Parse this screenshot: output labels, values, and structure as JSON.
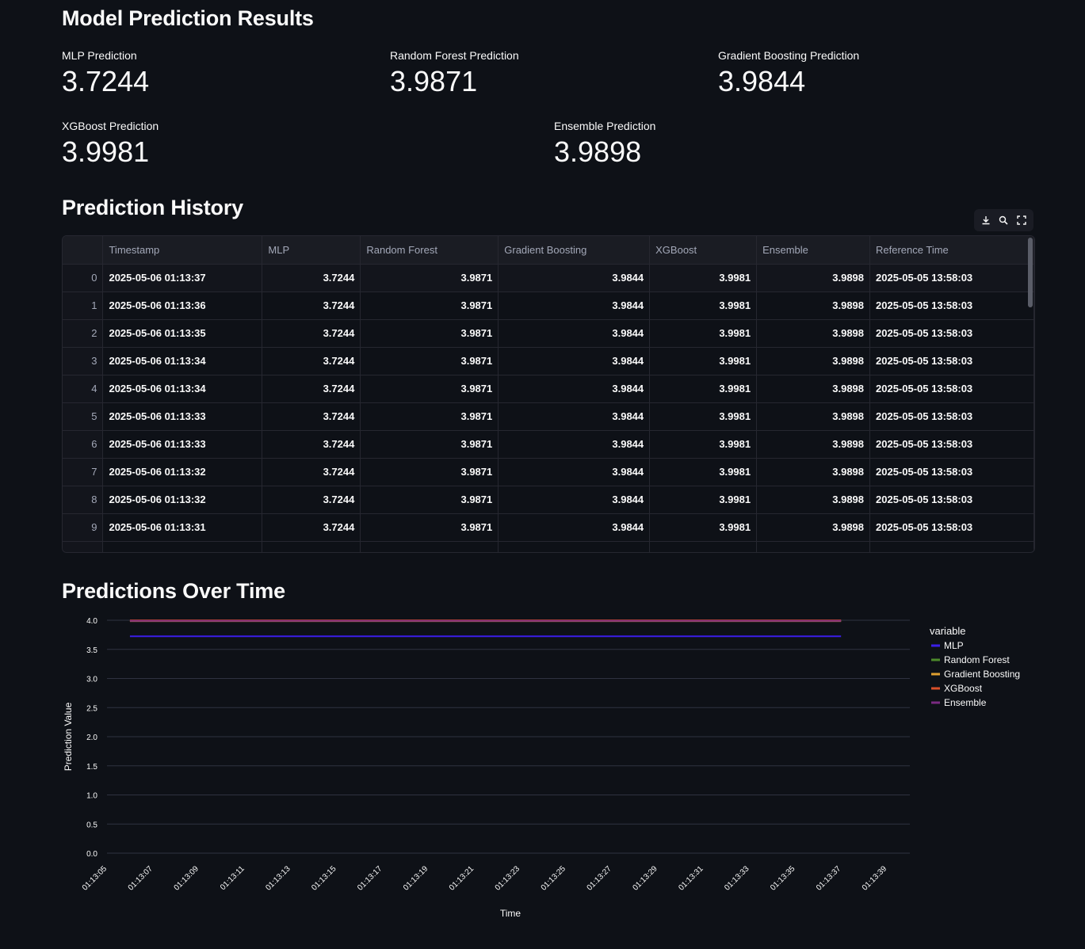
{
  "results": {
    "title": "Model Prediction Results",
    "metrics": [
      {
        "label": "MLP Prediction",
        "value": "3.7244"
      },
      {
        "label": "Random Forest Prediction",
        "value": "3.9871"
      },
      {
        "label": "Gradient Boosting Prediction",
        "value": "3.9844"
      },
      {
        "label": "XGBoost Prediction",
        "value": "3.9981"
      },
      {
        "label": "Ensemble Prediction",
        "value": "3.9898"
      }
    ]
  },
  "history": {
    "title": "Prediction History",
    "toolbar": {
      "download_icon": "download-icon",
      "search_icon": "search-icon",
      "fullscreen_icon": "fullscreen-icon"
    },
    "columns": [
      "",
      "Timestamp",
      "MLP",
      "Random Forest",
      "Gradient Boosting",
      "XGBoost",
      "Ensemble",
      "Reference Time"
    ],
    "rows": [
      [
        "0",
        "2025-05-06 01:13:37",
        "3.7244",
        "3.9871",
        "3.9844",
        "3.9981",
        "3.9898",
        "2025-05-05 13:58:03"
      ],
      [
        "1",
        "2025-05-06 01:13:36",
        "3.7244",
        "3.9871",
        "3.9844",
        "3.9981",
        "3.9898",
        "2025-05-05 13:58:03"
      ],
      [
        "2",
        "2025-05-06 01:13:35",
        "3.7244",
        "3.9871",
        "3.9844",
        "3.9981",
        "3.9898",
        "2025-05-05 13:58:03"
      ],
      [
        "3",
        "2025-05-06 01:13:34",
        "3.7244",
        "3.9871",
        "3.9844",
        "3.9981",
        "3.9898",
        "2025-05-05 13:58:03"
      ],
      [
        "4",
        "2025-05-06 01:13:34",
        "3.7244",
        "3.9871",
        "3.9844",
        "3.9981",
        "3.9898",
        "2025-05-05 13:58:03"
      ],
      [
        "5",
        "2025-05-06 01:13:33",
        "3.7244",
        "3.9871",
        "3.9844",
        "3.9981",
        "3.9898",
        "2025-05-05 13:58:03"
      ],
      [
        "6",
        "2025-05-06 01:13:33",
        "3.7244",
        "3.9871",
        "3.9844",
        "3.9981",
        "3.9898",
        "2025-05-05 13:58:03"
      ],
      [
        "7",
        "2025-05-06 01:13:32",
        "3.7244",
        "3.9871",
        "3.9844",
        "3.9981",
        "3.9898",
        "2025-05-05 13:58:03"
      ],
      [
        "8",
        "2025-05-06 01:13:32",
        "3.7244",
        "3.9871",
        "3.9844",
        "3.9981",
        "3.9898",
        "2025-05-05 13:58:03"
      ],
      [
        "9",
        "2025-05-06 01:13:31",
        "3.7244",
        "3.9871",
        "3.9844",
        "3.9981",
        "3.9898",
        "2025-05-05 13:58:03"
      ],
      [
        "",
        "",
        "",
        "",
        "",
        "",
        "",
        ""
      ]
    ]
  },
  "chart_section": {
    "title": "Predictions Over Time"
  },
  "chart_data": {
    "type": "line",
    "title": "",
    "xlabel": "Time",
    "ylabel": "Prediction Value",
    "legend_title": "variable",
    "legend_position": "right",
    "grid": true,
    "ylim": [
      0,
      4.0
    ],
    "yticks": [
      "0.0",
      "0.5",
      "1.0",
      "1.5",
      "2.0",
      "2.5",
      "3.0",
      "3.5",
      "4.0"
    ],
    "x_ticks": [
      "01:13:05",
      "01:13:07",
      "01:13:09",
      "01:13:11",
      "01:13:13",
      "01:13:15",
      "01:13:17",
      "01:13:19",
      "01:13:21",
      "01:13:23",
      "01:13:25",
      "01:13:27",
      "01:13:29",
      "01:13:31",
      "01:13:33",
      "01:13:35",
      "01:13:37",
      "01:13:39"
    ],
    "x_range": [
      "01:13:05",
      "01:13:40"
    ],
    "series": [
      {
        "name": "MLP",
        "color": "#3b1ee8",
        "x": [
          "01:13:06",
          "01:13:37"
        ],
        "values": [
          3.7244,
          3.7244
        ]
      },
      {
        "name": "Random Forest",
        "color": "#4c8a2b",
        "x": [
          "01:13:06",
          "01:13:37"
        ],
        "values": [
          3.9871,
          3.9871
        ]
      },
      {
        "name": "Gradient Boosting",
        "color": "#e0a030",
        "x": [
          "01:13:06",
          "01:13:37"
        ],
        "values": [
          3.9844,
          3.9844
        ]
      },
      {
        "name": "XGBoost",
        "color": "#d9502a",
        "x": [
          "01:13:06",
          "01:13:37"
        ],
        "values": [
          3.9981,
          3.9981
        ]
      },
      {
        "name": "Ensemble",
        "color": "#7a2a82",
        "x": [
          "01:13:06",
          "01:13:37"
        ],
        "values": [
          3.9898,
          3.9898
        ]
      }
    ]
  }
}
